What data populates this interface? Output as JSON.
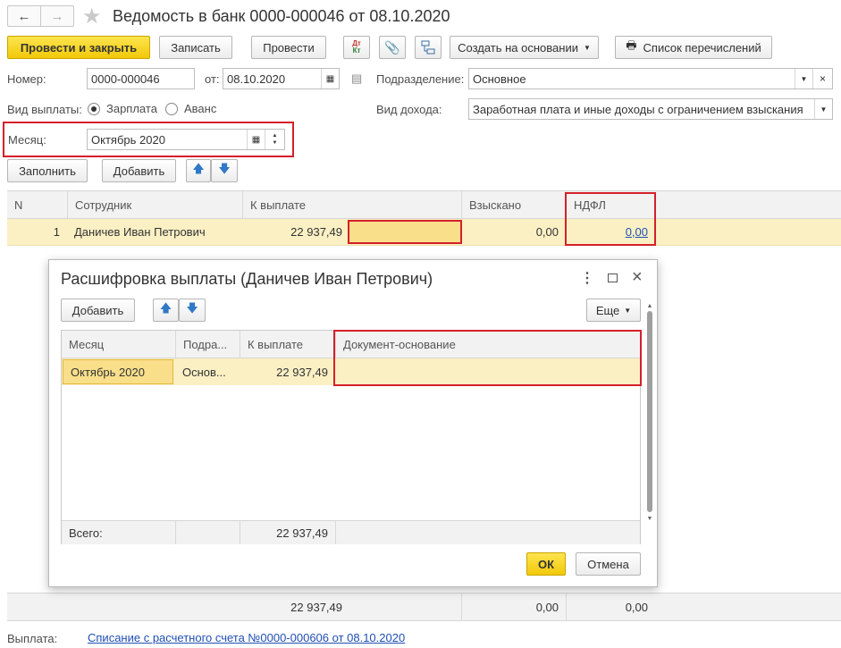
{
  "window": {
    "title": "Ведомость в банк 0000-000046 от 08.10.2020"
  },
  "toolbar": {
    "post_close": "Провести и закрыть",
    "save": "Записать",
    "post": "Провести",
    "create_based": "Создать на основании",
    "list_transfers": "Список перечислений"
  },
  "form": {
    "number_label": "Номер:",
    "number_value": "0000-000046",
    "from_label": "от:",
    "date_value": "08.10.2020",
    "subdivision_label": "Подразделение:",
    "subdivision_value": "Основное",
    "payment_type_label": "Вид выплаты:",
    "radio_salary": "Зарплата",
    "radio_advance": "Аванс",
    "income_type_label": "Вид дохода:",
    "income_type_value": "Заработная плата и иные доходы с ограничением взыскания",
    "month_label": "Месяц:",
    "month_value": "Октябрь 2020"
  },
  "table_toolbar": {
    "fill": "Заполнить",
    "add": "Добавить"
  },
  "table": {
    "headers": {
      "n": "N",
      "employee": "Сотрудник",
      "to_pay": "К выплате",
      "withheld": "Взыскано",
      "ndfl": "НДФЛ"
    },
    "rows": [
      {
        "n": "1",
        "employee": "Даничев Иван Петрович",
        "to_pay": "22 937,49",
        "withheld": "0,00",
        "ndfl": "0,00"
      }
    ],
    "totals": {
      "to_pay": "22 937,49",
      "withheld": "0,00",
      "ndfl": "0,00"
    }
  },
  "footer": {
    "payment_label": "Выплата:",
    "payment_link": "Списание с расчетного счета №0000-000606 от 08.10.2020"
  },
  "dialog": {
    "title": "Расшифровка выплаты (Даничев Иван Петрович)",
    "add": "Добавить",
    "more": "Еще",
    "headers": {
      "month": "Месяц",
      "subdivision": "Подра...",
      "to_pay": "К выплате",
      "basis_doc": "Документ-основание"
    },
    "rows": [
      {
        "month": "Октябрь 2020",
        "subdivision": "Основ...",
        "to_pay": "22 937,49",
        "basis_doc": ""
      }
    ],
    "total_label": "Всего:",
    "total_to_pay": "22 937,49",
    "ok": "ОК",
    "cancel": "Отмена"
  },
  "colors": {
    "accent_yellow": "#f5d31c",
    "highlight_row": "#fbf0c4",
    "red_frame": "#d4202b",
    "link": "#1f4fb4"
  }
}
